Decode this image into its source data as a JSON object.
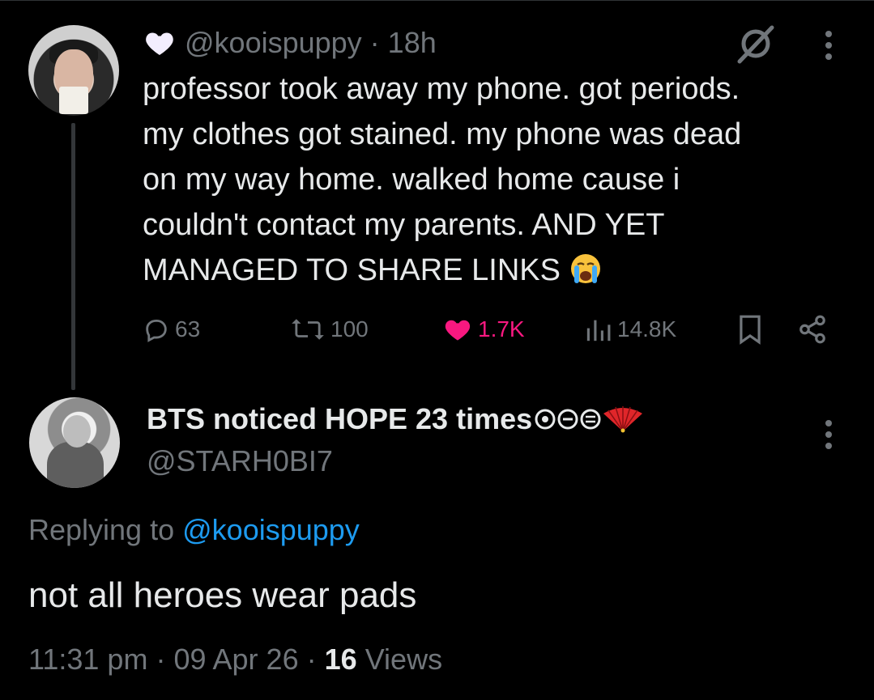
{
  "parent_tweet": {
    "handle": "@kooispuppy",
    "separator": "·",
    "time": "18h",
    "text": "professor took away my phone. got periods.\nmy clothes got stained. my phone was dead\non my way home. walked home cause i\ncouldn't contact my parents. AND YET\nMANAGED TO SHARE LINKS",
    "emoji_icon": "crying-face-icon",
    "stats": {
      "replies": "63",
      "reposts": "100",
      "likes": "1.7K",
      "views": "14.8K"
    },
    "colors": {
      "like": "#f91880",
      "muted": "#71767b",
      "text": "#e7e9ea"
    }
  },
  "reply_tweet": {
    "display_name": "BTS noticed HOPE 23 times",
    "handle": "@STARH0BI7",
    "replying_prefix": "Replying to",
    "replying_to": "@kooispuppy",
    "text": "not all heroes wear pads",
    "time": "11:31 pm",
    "date": "09 Apr 26",
    "views_count": "16",
    "views_label": "Views",
    "separator": "·",
    "colors": {
      "mention": "#1d9bf0"
    }
  }
}
